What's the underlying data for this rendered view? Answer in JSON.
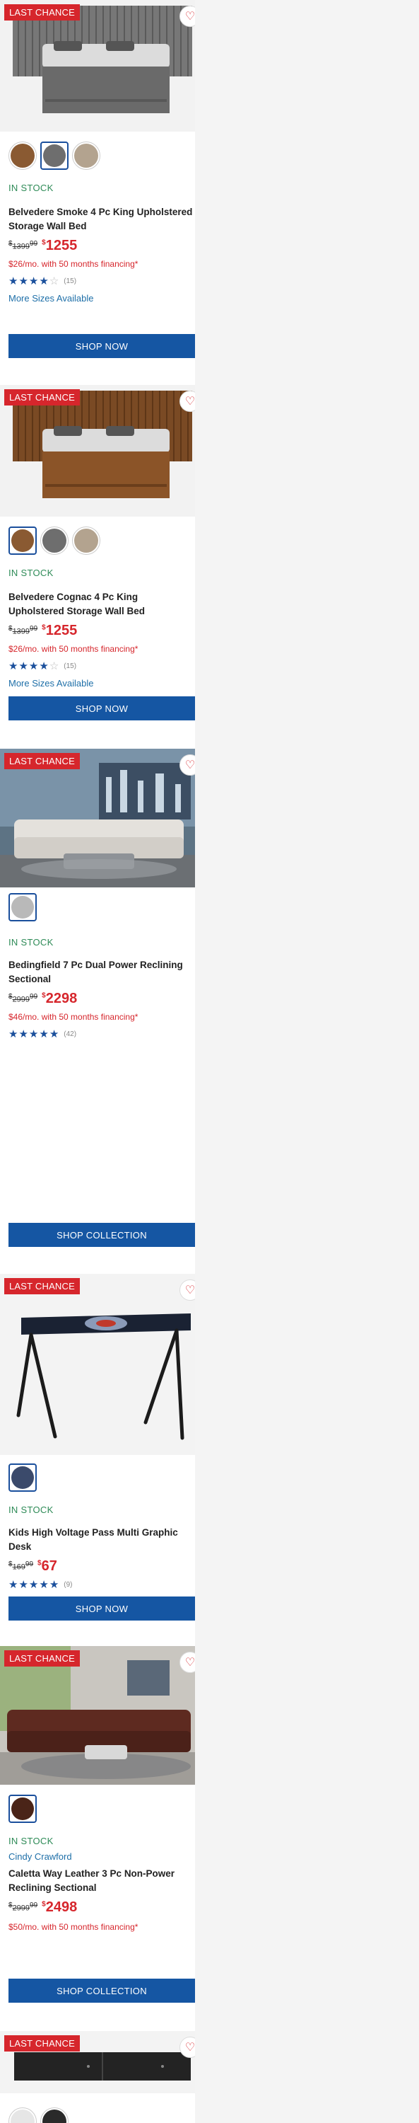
{
  "products": [
    {
      "badge": "LAST CHANCE",
      "stock": "IN STOCK",
      "name": "Belvedere Smoke 4 Pc King Upholstered Storage Wall Bed",
      "was": "1399",
      "was_cents": "99",
      "price": "1255",
      "currency": "$",
      "finance": "$26/mo. with 50 months financing*",
      "rating": 3.5,
      "reviews": "(15)",
      "more": "More Sizes Available",
      "cta": "SHOP NOW",
      "swatches": [
        "#8a5a32",
        "#6e6e6e",
        "#b3a38f"
      ],
      "selected_swatch": 1
    },
    {
      "badge": "LAST CHANCE",
      "stock": "IN STOCK",
      "name": "Belvedere Cognac 4 Pc King Upholstered Storage Wall Bed",
      "was": "1399",
      "was_cents": "99",
      "price": "1255",
      "currency": "$",
      "finance": "$26/mo. with 50 months financing*",
      "rating": 3.5,
      "reviews": "(15)",
      "more": "More Sizes Available",
      "cta": "SHOP NOW",
      "swatches": [
        "#8a5a32",
        "#6e6e6e",
        "#b3a38f"
      ],
      "selected_swatch": 0
    },
    {
      "badge": "LAST CHANCE",
      "stock": "IN STOCK",
      "name": "Bedingfield 7 Pc Dual Power Reclining Sectional",
      "was": "2999",
      "was_cents": "99",
      "price": "2298",
      "currency": "$",
      "finance": "$46/mo. with 50 months financing*",
      "rating": 5,
      "reviews": "(42)",
      "cta": "SHOP COLLECTION",
      "swatches": [
        "#b9b9b9"
      ],
      "selected_swatch": 0
    },
    {
      "badge": "LAST CHANCE",
      "stock": "IN STOCK",
      "name": "Kids High Voltage Pass Multi Graphic Desk",
      "was": "169",
      "was_cents": "99",
      "price": "67",
      "currency": "$",
      "rating": 4.5,
      "reviews": "(9)",
      "cta": "SHOP NOW",
      "swatches": [
        "#3b4a6b"
      ],
      "selected_swatch": 0
    },
    {
      "badge": "LAST CHANCE",
      "stock": "IN STOCK",
      "brand": "Cindy Crawford",
      "name": "Caletta Way Leather 3 Pc Non-Power Reclining Sectional",
      "was": "2999",
      "was_cents": "99",
      "price": "2498",
      "currency": "$",
      "finance": "$50/mo. with 50 months financing*",
      "cta": "SHOP COLLECTION",
      "swatches": [
        "#4a2418"
      ],
      "selected_swatch": 0
    },
    {
      "badge": "LAST CHANCE",
      "swatches": [
        "#e6e6e6",
        "#2a2a2a"
      ],
      "selected_swatch": 1
    }
  ]
}
